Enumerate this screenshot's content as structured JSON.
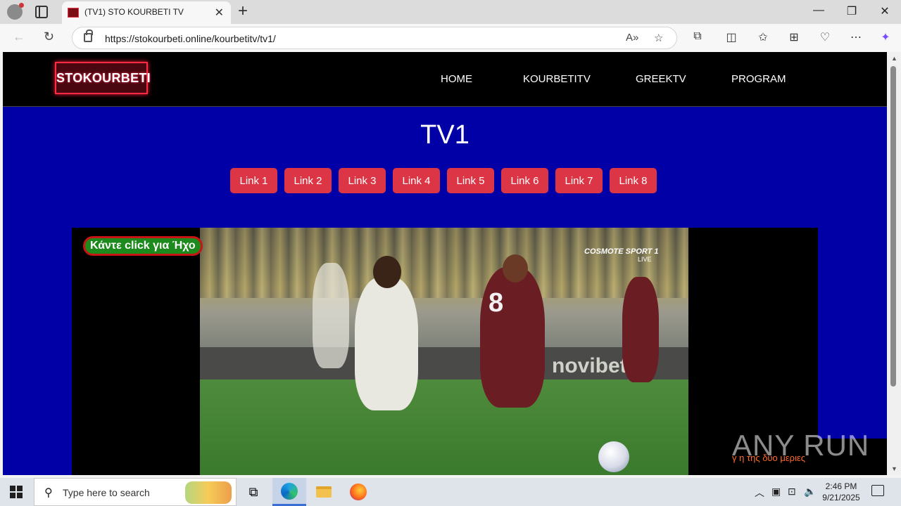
{
  "browser": {
    "tab_title": "(TV1) STO KOURBETI TV",
    "tab_close": "✕",
    "new_tab": "+",
    "url": "https://stokourbeti.online/kourbetitv/tv1/",
    "window_controls": {
      "minimize": "—",
      "maximize": "❐",
      "close": "✕"
    },
    "icons": [
      "back-icon",
      "refresh-icon",
      "lock-icon",
      "read-aloud-icon",
      "favorite-star-icon",
      "extensions-icon",
      "split-screen-icon",
      "favorites-icon",
      "collections-icon",
      "browser-essentials-icon",
      "more-icon",
      "copilot-icon"
    ]
  },
  "site": {
    "logo_text": "STOKOURBETI",
    "nav": [
      "HOME",
      "KOURBETITV",
      "GREEKTV",
      "PROGRAM"
    ],
    "channel_title": "TV1",
    "links": [
      "Link 1",
      "Link 2",
      "Link 3",
      "Link 4",
      "Link 5",
      "Link 6",
      "Link 7",
      "Link 8"
    ],
    "link_color": "#dc3545",
    "page_background": "#0000a6",
    "player": {
      "sound_button": "Κάντε click για Ήχο",
      "broadcaster": "COSMOTE SPORT 1",
      "live": "LIVE",
      "jersey_number": "8",
      "ad_text": "novibet"
    },
    "scroll_note": "γ η της δυο μεριες",
    "watermark": "ANY RUN"
  },
  "taskbar": {
    "search_placeholder": "Type here to search",
    "time": "2:46 PM",
    "date": "9/21/2025"
  }
}
